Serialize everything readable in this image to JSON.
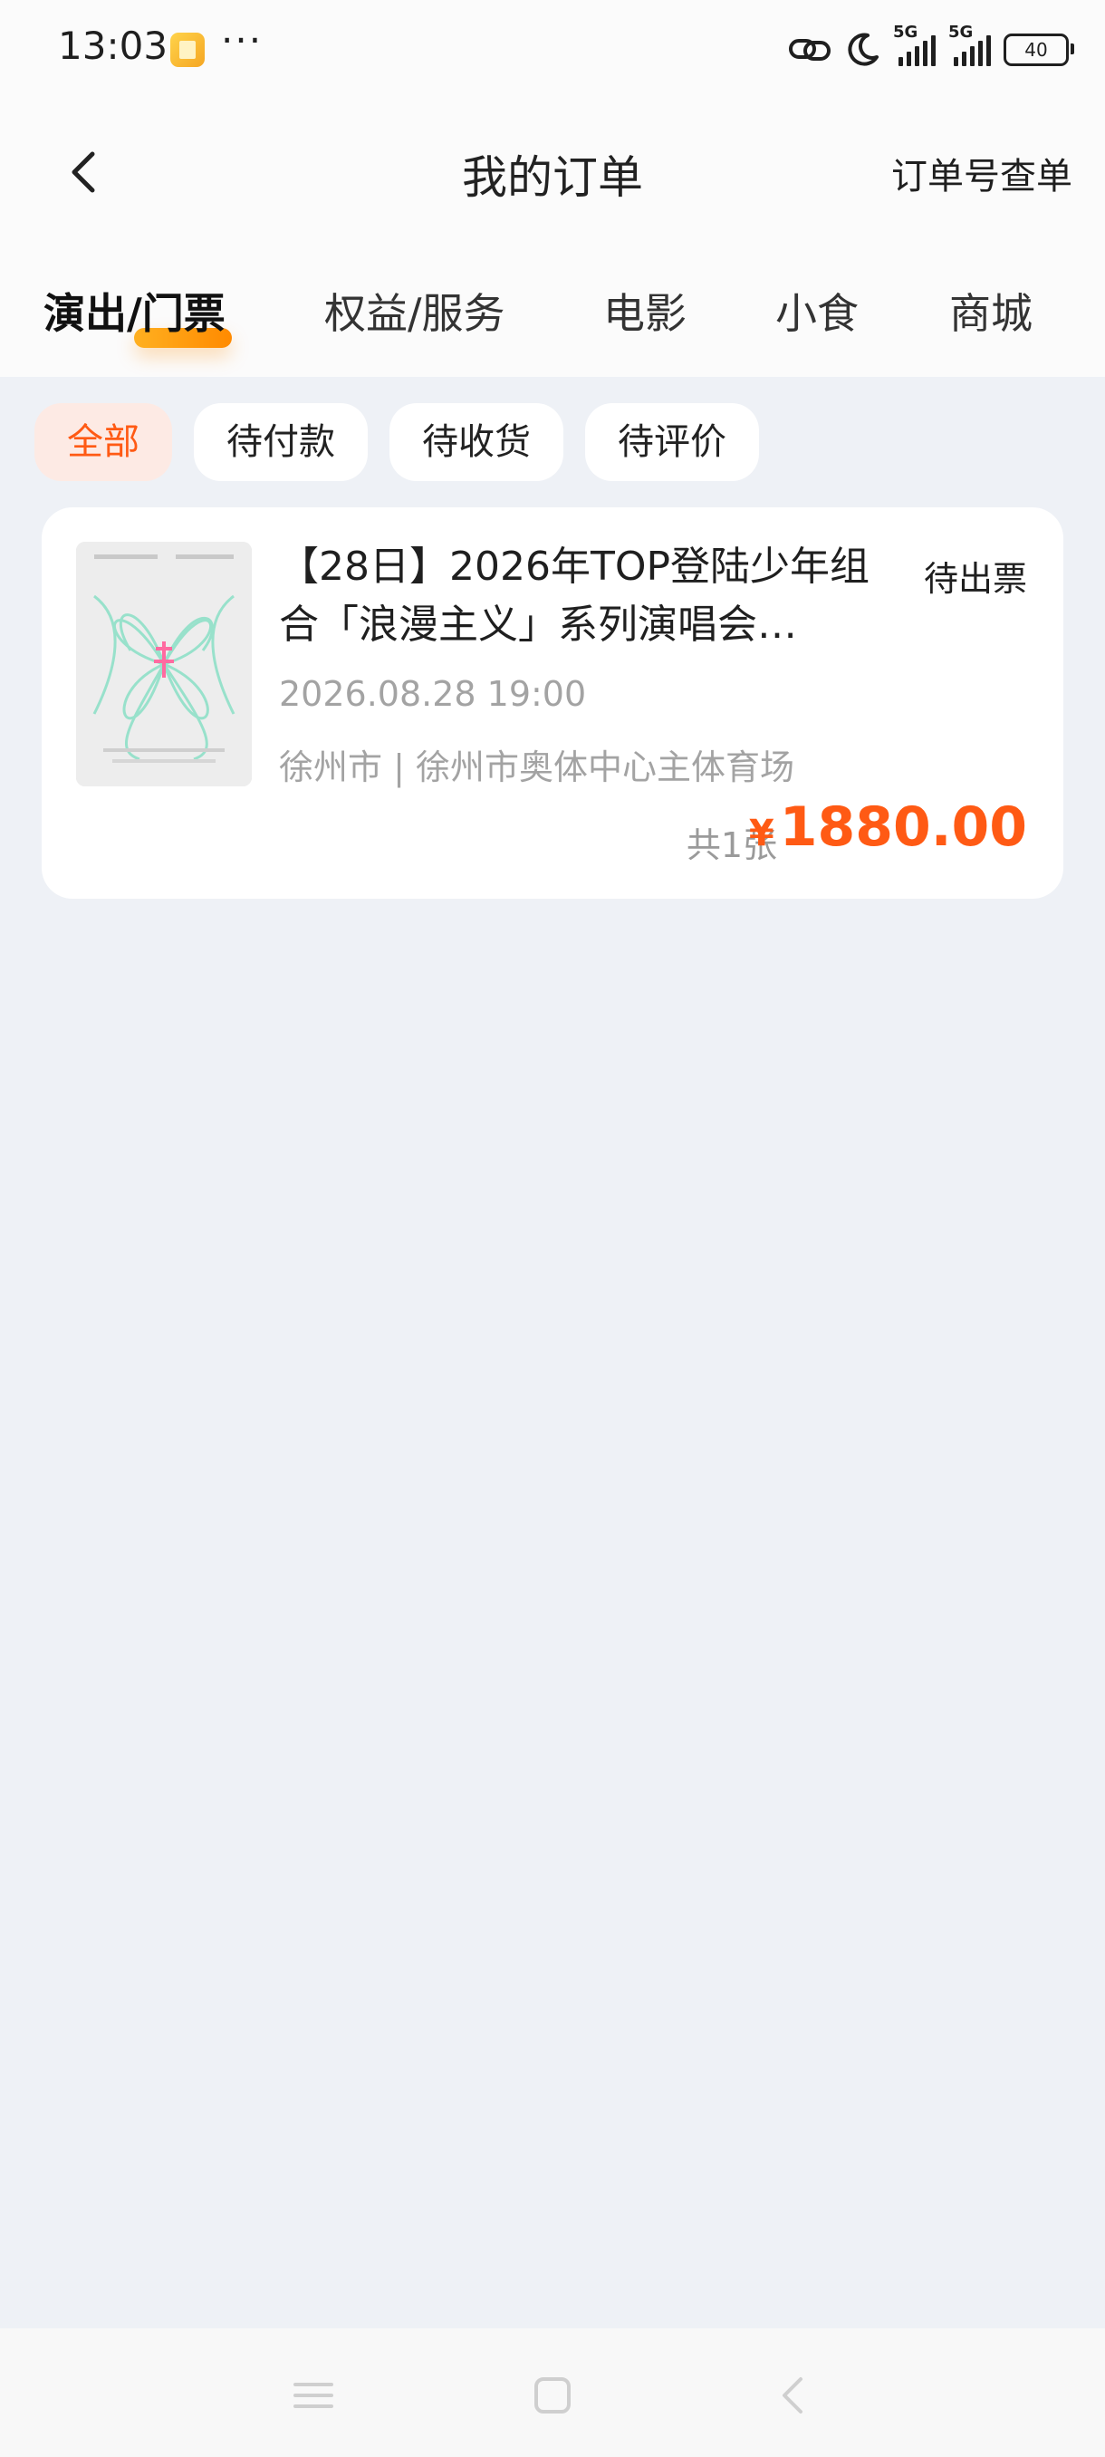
{
  "status_bar": {
    "time": "13:03",
    "more": "···",
    "network_1": "5G",
    "network_2": "5G",
    "battery": "40",
    "icons": [
      "app-notification-icon",
      "link-icon",
      "moon-icon",
      "signal-icon",
      "battery-icon"
    ]
  },
  "nav": {
    "title": "我的订单",
    "lookup_label": "订单号查单",
    "back_icon": "chevron-left-icon"
  },
  "tabs": [
    {
      "label": "演出/门票",
      "active": true
    },
    {
      "label": "权益/服务",
      "active": false
    },
    {
      "label": "电影",
      "active": false
    },
    {
      "label": "小食",
      "active": false
    },
    {
      "label": "商城",
      "active": false
    }
  ],
  "filters": [
    {
      "label": "全部",
      "active": true
    },
    {
      "label": "待付款",
      "active": false
    },
    {
      "label": "待收货",
      "active": false
    },
    {
      "label": "待评价",
      "active": false
    }
  ],
  "orders": [
    {
      "title": "【28日】2026年TOP登陆少年组合「浪漫主义」系列演唱会…",
      "status": "待出票",
      "datetime": "2026.08.28 19:00",
      "venue": "徐州市 | 徐州市奥体中心主体育场",
      "quantity": "共1张",
      "currency": "¥",
      "price": "1880.00"
    }
  ],
  "colors": {
    "accent": "#ff5a14",
    "tab_underline": "#ffa000",
    "page_bg": "#eef1f6",
    "card_bg": "#ffffff"
  }
}
